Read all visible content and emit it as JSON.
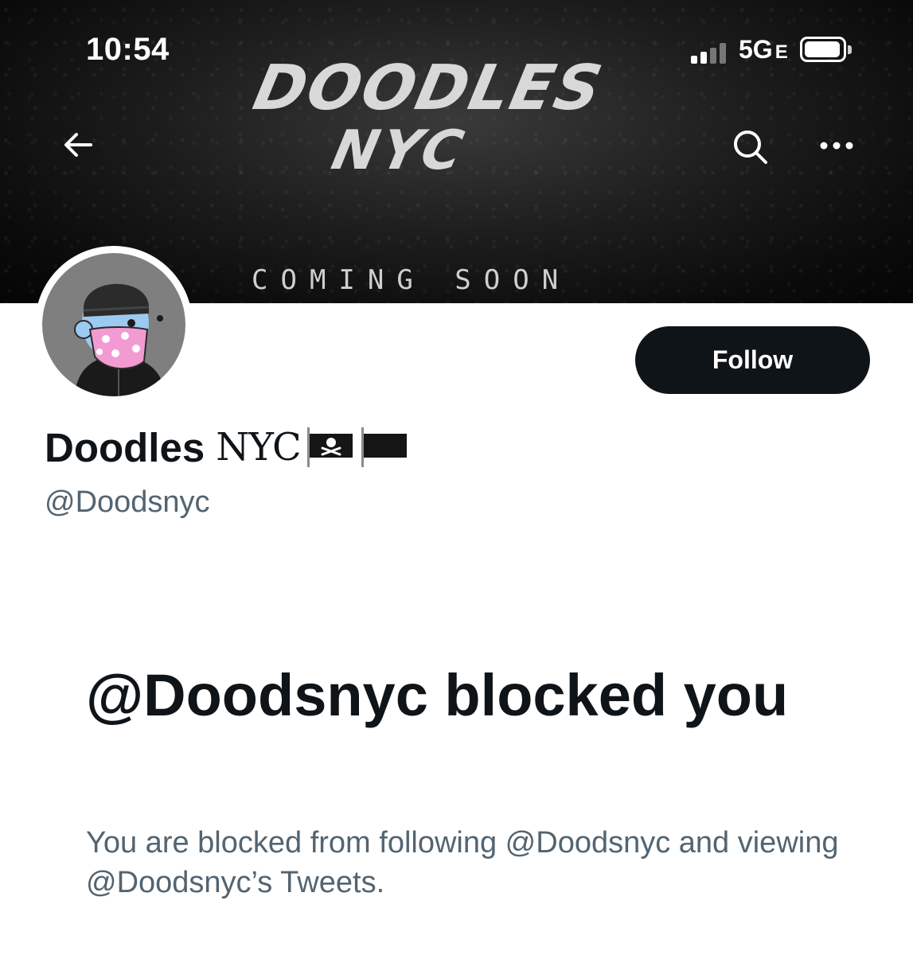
{
  "status_bar": {
    "time": "10:54",
    "network": "5G",
    "network_suffix": "E",
    "signal_bars_active": 2,
    "signal_bars_total": 4
  },
  "banner": {
    "title_line1": "DOODLES",
    "title_line2": "NYC",
    "subtitle": "COMING SOON"
  },
  "nav": {
    "back_icon": "arrow-left-icon",
    "search_icon": "search-icon",
    "more_icon": "more-horizontal-icon"
  },
  "profile": {
    "name": "Doodles",
    "name_stylized": "NYC",
    "name_emojis": [
      "pirate-flag",
      "black-flag"
    ],
    "handle": "@Doodsnyc",
    "follow_label": "Follow"
  },
  "blocked": {
    "title": "@Doodsnyc blocked you",
    "description": "You are blocked from following @Doodsnyc and viewing @Doodsnyc’s Tweets."
  },
  "colors": {
    "text_primary": "#0f1419",
    "text_secondary": "#536471",
    "button_bg": "#0f1419",
    "button_text": "#ffffff",
    "banner_bg": "#0b0b0b"
  }
}
